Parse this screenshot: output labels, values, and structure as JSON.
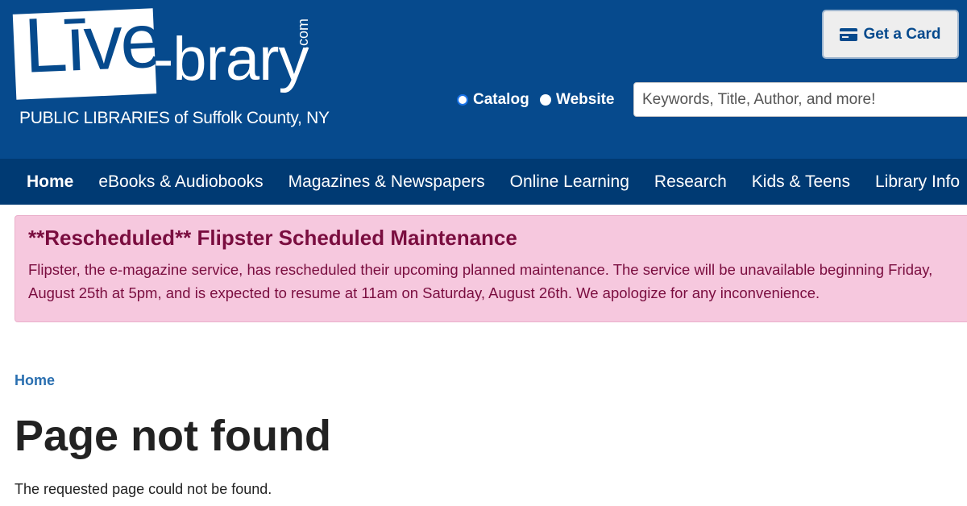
{
  "logo": {
    "live": "Līve",
    "brary": "-brary",
    "com": ".com",
    "tagline": "PUBLIC LIBRARIES of Suffolk County, NY"
  },
  "header": {
    "get_card_label": "Get a Card",
    "search_scope": [
      {
        "label": "Catalog",
        "selected": true
      },
      {
        "label": "Website",
        "selected": false
      }
    ],
    "search_placeholder": "Keywords, Title, Author, and more!"
  },
  "nav": {
    "items": [
      {
        "label": "Home",
        "active": true
      },
      {
        "label": "eBooks & Audiobooks"
      },
      {
        "label": "Magazines & Newspapers"
      },
      {
        "label": "Online Learning"
      },
      {
        "label": "Research"
      },
      {
        "label": "Kids & Teens"
      },
      {
        "label": "Library Info"
      }
    ]
  },
  "alert": {
    "title": "**Rescheduled** Flipster Scheduled Maintenance",
    "body": "Flipster, the e-magazine service, has rescheduled their upcoming planned maintenance. The service will be unavailable beginning  Friday, August 25th at 5pm, and is expected to resume at 11am on Saturday, August 26th. We apologize for any inconvenience."
  },
  "main": {
    "breadcrumb": "Home",
    "title": "Page not found",
    "message": "The requested page could not be found."
  },
  "colors": {
    "header_bg": "#064a8d",
    "nav_bg": "#003a73",
    "alert_bg": "#f6c8de",
    "alert_text": "#7a0d3f",
    "link": "#2a6fb0"
  }
}
